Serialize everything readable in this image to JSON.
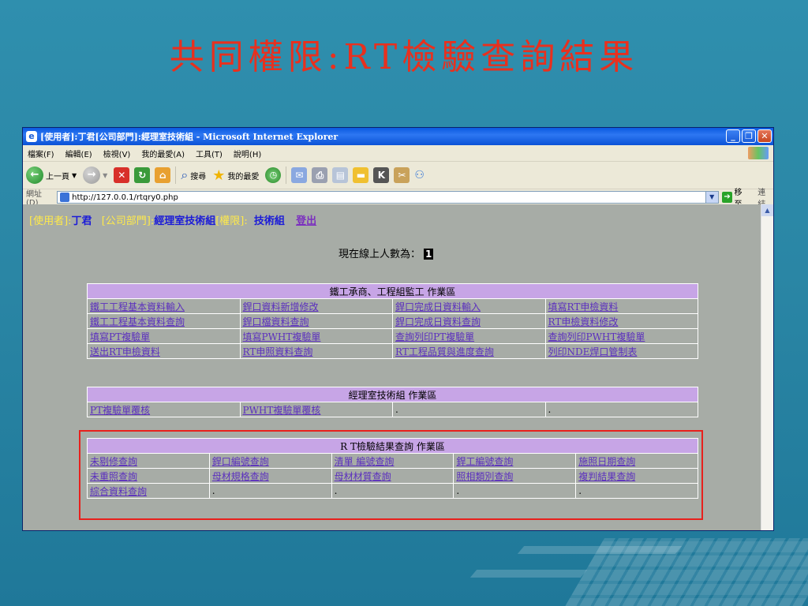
{
  "slide": {
    "title": "共同權限:RT檢驗查詢結果"
  },
  "window": {
    "title": "[使用者]:丁君[公司部門]:經理室技術組 - Microsoft Internet Explorer",
    "buttons": {
      "min": "_",
      "max": "❐",
      "close": "✕"
    }
  },
  "menu": [
    "檔案(F)",
    "編輯(E)",
    "檢視(V)",
    "我的最愛(A)",
    "工具(T)",
    "說明(H)"
  ],
  "toolbar": {
    "back": "上一頁",
    "search": "搜尋",
    "favorites": "我的最愛"
  },
  "address": {
    "label": "網址(D)",
    "url": "http://127.0.0.1/rtqry0.php",
    "go": "移至",
    "links": "連結"
  },
  "user": {
    "user_label": "[使用者]:",
    "user_name": "丁君",
    "dept_label": "[公司部門]:",
    "dept_name": "經理室技術組",
    "perm_label": "[權限]:",
    "perm_name": "技術組",
    "logout": "登出"
  },
  "online": {
    "label": "現在線上人數為：",
    "count": "1"
  },
  "panel1": {
    "header": "鐵工承商、工程組監工 作業區",
    "rows": [
      [
        "鐵工工程基本資料輸入",
        "銲口資料新增修改",
        "銲口完成日資料輸入",
        "填寫RT申檢資料"
      ],
      [
        "鐵工工程基本資料查詢",
        "銲口檔資料查詢",
        "銲口完成日資料查詢",
        "RT申檢資料修改"
      ],
      [
        "填寫PT複驗單",
        "填寫PWHT複驗單",
        "查詢列印PT複驗單",
        "查詢列印PWHT複驗單"
      ],
      [
        "送出RT申檢資料",
        "RT申照資料查詢",
        "RT工程品質與進度查詢",
        "列印NDE焊口管制表"
      ]
    ]
  },
  "panel2": {
    "header": "經理室技術組 作業區",
    "rows": [
      [
        "PT複驗單覆核",
        "PWHT複驗單覆核",
        ".",
        "."
      ]
    ]
  },
  "panel3": {
    "header": "R T檢驗結果查詢 作業區",
    "rows": [
      [
        "未剔修查詢",
        "銲口編號查詢",
        "清單 編號查詢",
        "銲工編號查詢",
        "施照日期查詢"
      ],
      [
        "未重照查詢",
        "母材規格查詢",
        "母材材質查詢",
        "照相類別查詢",
        "複判結果查詢"
      ],
      [
        "綜合資料查詢",
        ".",
        ".",
        ".",
        "."
      ]
    ]
  },
  "colors": {
    "title": "#e8301e",
    "panel_header": "#c7a5e6",
    "highlight": "#e8201c"
  }
}
